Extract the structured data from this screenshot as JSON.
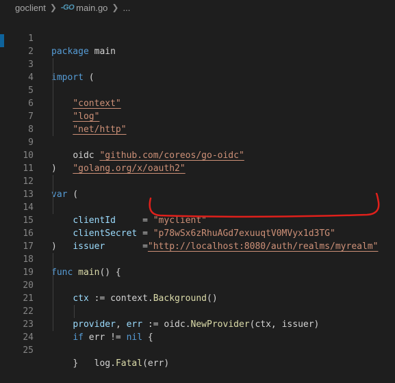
{
  "breadcrumb": {
    "folder": "goclient",
    "file": "main.go",
    "more": "..."
  },
  "annotation_color": "#e0201b",
  "code": {
    "l1": {
      "num": "1",
      "kw": "package",
      "rest": " main"
    },
    "l2": {
      "num": "2"
    },
    "l3": {
      "num": "3",
      "kw": "import",
      "rest": " ("
    },
    "l4": {
      "num": "4",
      "s": "\"context\""
    },
    "l5": {
      "num": "5",
      "s": "\"log\""
    },
    "l6": {
      "num": "6",
      "s": "\"net/http\""
    },
    "l7": {
      "num": "7"
    },
    "l8": {
      "num": "8",
      "alias": "oidc",
      "s": "\"github.com/coreos/go-oidc\""
    },
    "l9": {
      "num": "9",
      "s": "\"golang.org/x/oauth2\""
    },
    "l10": {
      "num": "10",
      "rest": ")"
    },
    "l11": {
      "num": "11"
    },
    "l12": {
      "num": "12",
      "kw": "var",
      "rest": " ("
    },
    "l13": {
      "num": "13",
      "name": "clientId",
      "pad": "     ",
      "eq": "= ",
      "s": "\"myclient\""
    },
    "l14": {
      "num": "14",
      "name": "clientSecret",
      "pad": " ",
      "eq": "= ",
      "s": "\"p78wSx6zRhuAGd7exuuqtV0MVyx1d3TG\""
    },
    "l15": {
      "num": "15",
      "name": "issuer",
      "pad": "       ",
      "eq": "=",
      "s": "\"http://localhost:8080/auth/realms/myrealm\""
    },
    "l16": {
      "num": "16",
      "rest": ")"
    },
    "l17": {
      "num": "17"
    },
    "l18": {
      "num": "18",
      "kw": "func",
      "fn": "main",
      "rest": "() {"
    },
    "l19": {
      "num": "19",
      "id": "ctx",
      "op": " := context.",
      "fn": "Background",
      "rest": "()"
    },
    "l20": {
      "num": "20"
    },
    "l21": {
      "num": "21",
      "id": "provider",
      "rest1": ", ",
      "id2": "err",
      "op": " := oidc.",
      "fn": "NewProvider",
      "args": "(ctx, issuer)"
    },
    "l22": {
      "num": "22",
      "kw": "if",
      "rest1": " err != ",
      "kw2": "nil",
      "rest": " {"
    },
    "l23": {
      "num": "23",
      "pre": "log.",
      "fn": "Fatal",
      "rest": "(err)"
    },
    "l24": {
      "num": "24",
      "rest": "}"
    },
    "l25": {
      "num": "25"
    }
  }
}
